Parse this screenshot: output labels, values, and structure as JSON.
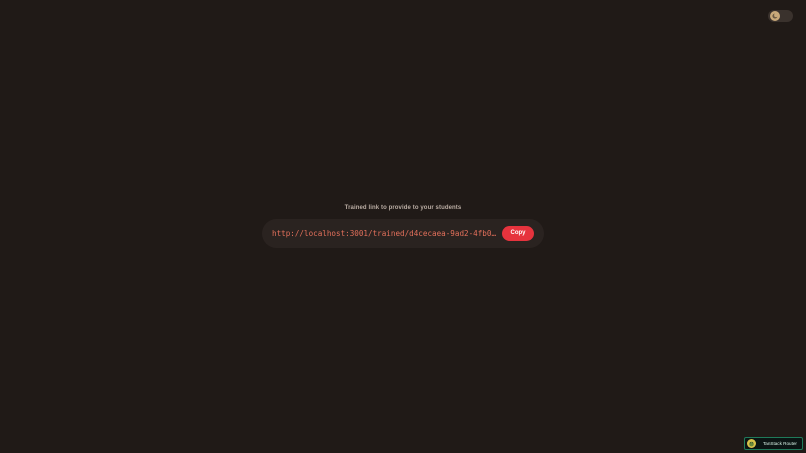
{
  "theme_toggle": {
    "icon": "sun-moon-icon"
  },
  "share": {
    "label": "Trained link to provide to your students",
    "link": "http://localhost:3001/trained/d4cecaea-9ad2-4fb0-af17…",
    "copy_label": "Copy"
  },
  "devtools": {
    "label": "TanStack Router",
    "icon": "tanstack-logo-icon"
  },
  "colors": {
    "background": "#201a17",
    "card": "#2a2320",
    "link_text": "#e3705b",
    "copy_button": "#e6333d",
    "label_text": "#b9aca3"
  }
}
